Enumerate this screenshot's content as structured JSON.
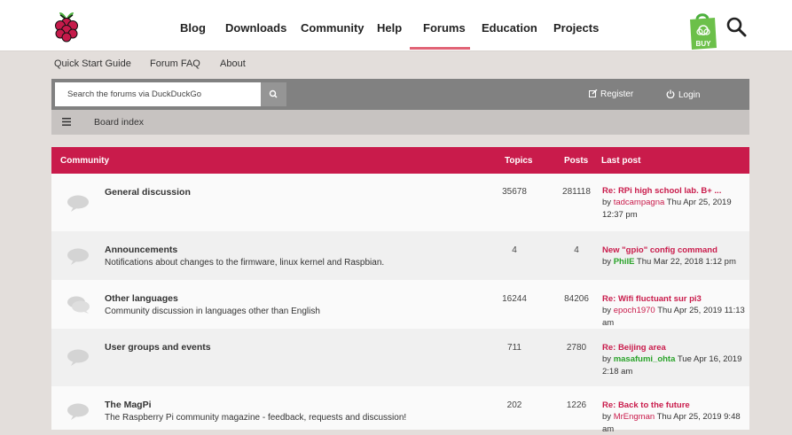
{
  "nav": {
    "items": [
      "Blog",
      "Downloads",
      "Community",
      "Help",
      "Forums",
      "Education",
      "Projects"
    ],
    "active": "Forums",
    "buy_label": "BUY"
  },
  "subnav": [
    "Quick Start Guide",
    "Forum FAQ",
    "About"
  ],
  "search": {
    "placeholder": "Search the forums via DuckDuckGo"
  },
  "auth": {
    "register": "Register",
    "login": "Login"
  },
  "breadcrumb": "Board index",
  "table": {
    "headers": {
      "forum": "Community",
      "topics": "Topics",
      "posts": "Posts",
      "lastpost": "Last post"
    },
    "rows": [
      {
        "title": "General discussion",
        "desc": "",
        "topics": "35678",
        "posts": "281118",
        "lp_title": "Re: RPi high school lab. B+ ...",
        "by": "by",
        "user": "tadcampagna",
        "time": "Thu Apr 25, 2019 12:37 pm"
      },
      {
        "title": "Announcements",
        "desc": "Notifications about changes to the firmware, linux kernel and Raspbian.",
        "topics": "4",
        "posts": "4",
        "lp_title": "New \"gpio\" config command",
        "by": "by",
        "user": "PhilE",
        "time": "Thu Mar 22, 2018 1:12 pm"
      },
      {
        "title": "Other languages",
        "desc": "Community discussion in languages other than English",
        "topics": "16244",
        "posts": "84206",
        "lp_title": "Re: Wifi fluctuant sur pi3",
        "by": "by",
        "user": "epoch1970",
        "time": "Thu Apr 25, 2019 11:13 am"
      },
      {
        "title": "User groups and events",
        "desc": "",
        "topics": "711",
        "posts": "2780",
        "lp_title": "Re: Beijing area",
        "by": "by",
        "user": "masafumi_ohta",
        "time": "Tue Apr 16, 2019 2:18 am"
      },
      {
        "title": "The MagPi",
        "desc": "The Raspberry Pi community magazine - feedback, requests and discussion!",
        "topics": "202",
        "posts": "1226",
        "lp_title": "Re: Back to the future",
        "by": "by",
        "user": "MrEngman",
        "time": "Thu Apr 25, 2019 9:48 am"
      }
    ]
  },
  "colors": {
    "accent": "#c91b4b",
    "moderator_green": "#29a329",
    "nav_active": "#e16376",
    "bar_gray": "#818181"
  }
}
